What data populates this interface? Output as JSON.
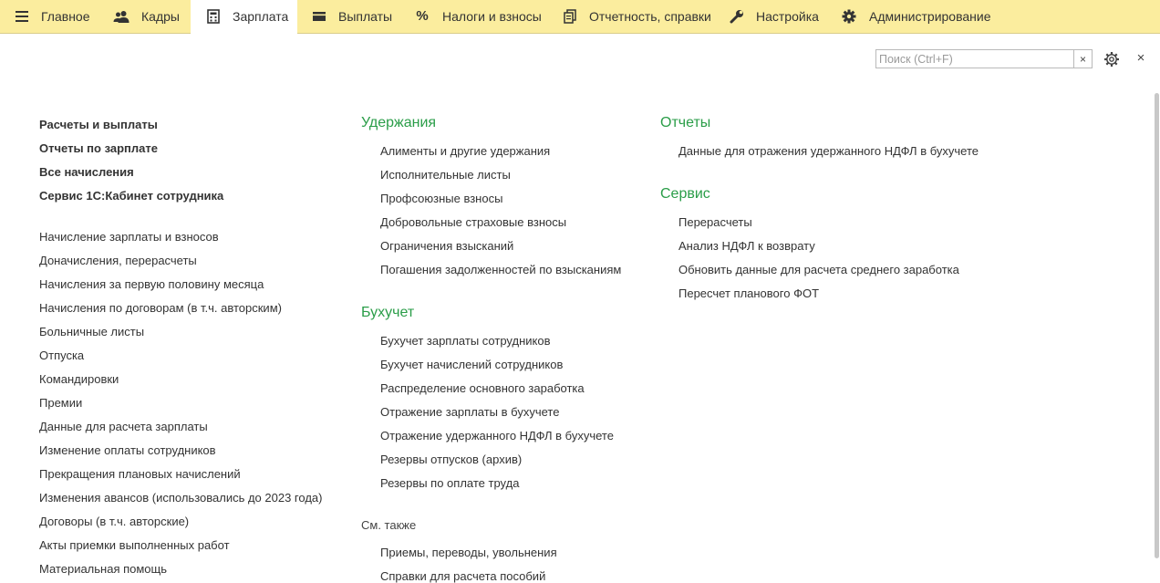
{
  "tabs": [
    {
      "label": "Главное",
      "icon": "menu-icon"
    },
    {
      "label": "Кадры",
      "icon": "users-icon"
    },
    {
      "label": "Зарплата",
      "icon": "calculator-icon",
      "active": true
    },
    {
      "label": "Выплаты",
      "icon": "wallet-icon"
    },
    {
      "label": "Налоги и взносы",
      "icon": "percent-icon"
    },
    {
      "label": "Отчетность, справки",
      "icon": "documents-icon"
    },
    {
      "label": "Настройка",
      "icon": "wrench-icon"
    },
    {
      "label": "Администрирование",
      "icon": "gear-icon"
    }
  ],
  "search": {
    "placeholder": "Поиск (Ctrl+F)",
    "value": "",
    "clear": "×"
  },
  "window": {
    "close": "×"
  },
  "col1": {
    "bold_links": [
      "Расчеты и выплаты",
      "Отчеты по зарплате",
      "Все начисления",
      "Сервис 1С:Кабинет сотрудника"
    ],
    "links": [
      "Начисление зарплаты и взносов",
      "Доначисления, перерасчеты",
      "Начисления за первую половину месяца",
      "Начисления по договорам (в т.ч. авторским)",
      "Больничные листы",
      "Отпуска",
      "Командировки",
      "Премии",
      "Данные для расчета зарплаты",
      "Изменение оплаты сотрудников",
      "Прекращения плановых начислений",
      "Изменения авансов (использовались до 2023 года)",
      "Договоры (в т.ч. авторские)",
      "Акты приемки выполненных работ",
      "Материальная помощь"
    ]
  },
  "col2": {
    "uderzhaniya": {
      "title": "Удержания",
      "items": [
        "Алименты и другие удержания",
        "Исполнительные листы",
        "Профсоюзные взносы",
        "Добровольные страховые взносы",
        "Ограничения взысканий",
        "Погашения задолженностей по взысканиям"
      ]
    },
    "buhuchet": {
      "title": "Бухучет",
      "items": [
        "Бухучет зарплаты сотрудников",
        "Бухучет начислений сотрудников",
        "Распределение основного заработка",
        "Отражение зарплаты в бухучете",
        "Отражение удержанного НДФЛ в бухучете",
        "Резервы отпусков (архив)",
        "Резервы по оплате труда"
      ]
    },
    "see_also": {
      "title": "См. также",
      "items": [
        "Приемы, переводы, увольнения",
        "Справки для расчета пособий"
      ]
    }
  },
  "col3": {
    "otchety": {
      "title": "Отчеты",
      "items": [
        "Данные для отражения удержанного НДФЛ в бухучете"
      ]
    },
    "servis": {
      "title": "Сервис",
      "items": [
        "Перерасчеты",
        "Анализ НДФЛ к возврату",
        "Обновить данные для расчета среднего заработка",
        "Пересчет планового ФОТ"
      ]
    }
  },
  "colors": {
    "topbar": "#fbed9e",
    "heading": "#2a9d48",
    "text": "#333333"
  }
}
